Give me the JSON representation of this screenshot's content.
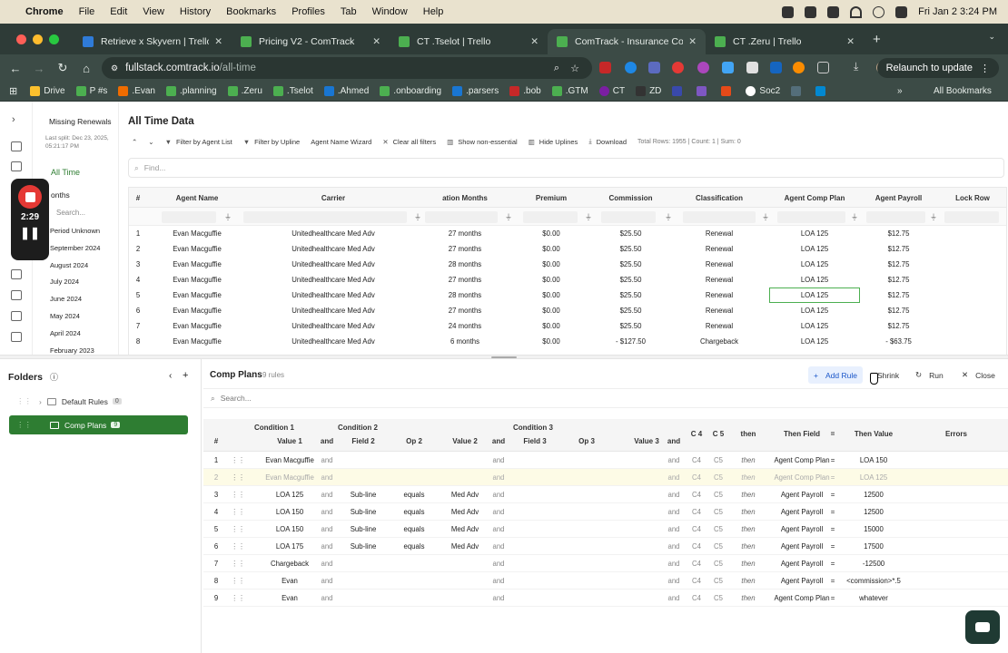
{
  "menubar": {
    "app": "Chrome",
    "items": [
      "File",
      "Edit",
      "View",
      "History",
      "Bookmarks",
      "Profiles",
      "Tab",
      "Window",
      "Help"
    ],
    "clock": "Fri Jan 2  3:24 PM"
  },
  "tabs": [
    {
      "title": "Retrieve x Skyvern | Trello",
      "active": false
    },
    {
      "title": "Pricing V2 - ComTrack",
      "active": false
    },
    {
      "title": "CT .Tselot | Trello",
      "active": false
    },
    {
      "title": "ComTrack - Insurance Comm",
      "active": true
    },
    {
      "title": "CT .Zeru | Trello",
      "active": false
    }
  ],
  "address": {
    "host": "fullstack.comtrack.io",
    "path": "/all-time",
    "relaunch": "Relaunch to update"
  },
  "bookmarks": [
    "Drive",
    "P #s",
    ".Evan",
    ".planning",
    ".Zeru",
    ".Tselot",
    ".Ahmed",
    ".onboarding",
    ".parsers",
    ".bob",
    ".GTM",
    "CT",
    "ZD",
    "",
    "",
    "Soc2",
    "",
    ""
  ],
  "bookmarks_all": "All Bookmarks",
  "recorder": {
    "time": "2:29"
  },
  "sidenav": {
    "title": "Missing Renewals",
    "subtitle": "Last split: Dec 23, 2025, 05:21:17 PM",
    "alltime": "All Time",
    "months_label": "onths",
    "search": "Search...",
    "months": [
      "Period Unknown",
      "September 2024",
      "August 2024",
      "July 2024",
      "June 2024",
      "May 2024",
      "April 2024",
      "February 2023"
    ]
  },
  "main": {
    "title": "All Time Data",
    "toolbar": [
      "Filter by Agent List",
      "Filter by Upline",
      "Agent Name Wizard",
      "Clear all filters",
      "Show non-essential",
      "Hide Uplines",
      "Download"
    ],
    "stats": "Total Rows: 1955 | Count: 1 | Sum: 0",
    "find_placeholder": "Find...",
    "columns": [
      "#",
      "Agent Name",
      "Carrier",
      "ation Months",
      "Premium",
      "Commission",
      "Classification",
      "Agent Comp Plan",
      "Agent Payroll",
      "Lock Row"
    ],
    "rows": [
      [
        "1",
        "Evan Macguffie",
        "Unitedhealthcare Med Adv",
        "27 months",
        "$0.00",
        "$25.50",
        "Renewal",
        "LOA 125",
        "$12.75"
      ],
      [
        "2",
        "Evan Macguffie",
        "Unitedhealthcare Med Adv",
        "27 months",
        "$0.00",
        "$25.50",
        "Renewal",
        "LOA 125",
        "$12.75"
      ],
      [
        "3",
        "Evan Macguffie",
        "Unitedhealthcare Med Adv",
        "28 months",
        "$0.00",
        "$25.50",
        "Renewal",
        "LOA 125",
        "$12.75"
      ],
      [
        "4",
        "Evan Macguffie",
        "Unitedhealthcare Med Adv",
        "27 months",
        "$0.00",
        "$25.50",
        "Renewal",
        "LOA 125",
        "$12.75"
      ],
      [
        "5",
        "Evan Macguffie",
        "Unitedhealthcare Med Adv",
        "28 months",
        "$0.00",
        "$25.50",
        "Renewal",
        "LOA 125",
        "$12.75"
      ],
      [
        "6",
        "Evan Macguffie",
        "Unitedhealthcare Med Adv",
        "27 months",
        "$0.00",
        "$25.50",
        "Renewal",
        "LOA 125",
        "$12.75"
      ],
      [
        "7",
        "Evan Macguffie",
        "Unitedhealthcare Med Adv",
        "24 months",
        "$0.00",
        "$25.50",
        "Renewal",
        "LOA 125",
        "$12.75"
      ],
      [
        "8",
        "Evan Macguffie",
        "Unitedhealthcare Med Adv",
        "6 months",
        "$0.00",
        "- $127.50",
        "Chargeback",
        "LOA 125",
        "- $63.75"
      ]
    ]
  },
  "folders": {
    "title": "Folders",
    "items": [
      {
        "label": "Default Rules",
        "count": "0"
      },
      {
        "label": "Comp Plans",
        "count": "9"
      }
    ]
  },
  "rules": {
    "title": "Comp Plans",
    "count": "9 rules",
    "add": "Add Rule",
    "shrink": "Shrink",
    "run": "Run",
    "close": "Close",
    "search": "Search...",
    "groups": [
      "Condition 1",
      "Condition 2",
      "Condition 3"
    ],
    "columns": [
      "#",
      "Value 1",
      "and",
      "Field 2",
      "Op 2",
      "Value 2",
      "and",
      "Field 3",
      "Op 3",
      "Value 3",
      "and",
      "C 4",
      "C 5",
      "then",
      "Then Field",
      "=",
      "Then Value",
      "Errors"
    ],
    "rows": [
      [
        "1",
        "Evan Macguffie",
        "and",
        "",
        "",
        "",
        "and",
        "",
        "",
        "",
        "and",
        "C4",
        "C5",
        "then",
        "Agent Comp Plan",
        "=",
        "LOA 150"
      ],
      [
        "2",
        "Evan Macguffie",
        "and",
        "",
        "",
        "",
        "and",
        "",
        "",
        "",
        "and",
        "C4",
        "C5",
        "then",
        "Agent Comp Plan",
        "=",
        "LOA 125"
      ],
      [
        "3",
        "LOA 125",
        "and",
        "Sub-line",
        "equals",
        "Med Adv",
        "and",
        "",
        "",
        "",
        "and",
        "C4",
        "C5",
        "then",
        "Agent Payroll",
        "=",
        "12500"
      ],
      [
        "4",
        "LOA 150",
        "and",
        "Sub-line",
        "equals",
        "Med Adv",
        "and",
        "",
        "",
        "",
        "and",
        "C4",
        "C5",
        "then",
        "Agent Payroll",
        "=",
        "12500"
      ],
      [
        "5",
        "LOA 150",
        "and",
        "Sub-line",
        "equals",
        "Med Adv",
        "and",
        "",
        "",
        "",
        "and",
        "C4",
        "C5",
        "then",
        "Agent Payroll",
        "=",
        "15000"
      ],
      [
        "6",
        "LOA 175",
        "and",
        "Sub-line",
        "equals",
        "Med Adv",
        "and",
        "",
        "",
        "",
        "and",
        "C4",
        "C5",
        "then",
        "Agent Payroll",
        "=",
        "17500"
      ],
      [
        "7",
        "Chargeback",
        "and",
        "",
        "",
        "",
        "and",
        "",
        "",
        "",
        "and",
        "C4",
        "C5",
        "then",
        "Agent Payroll",
        "=",
        "-12500"
      ],
      [
        "8",
        "Evan",
        "and",
        "",
        "",
        "",
        "and",
        "",
        "",
        "",
        "and",
        "C4",
        "C5",
        "then",
        "Agent Payroll",
        "=",
        "<commission>*.5"
      ],
      [
        "9",
        "Evan",
        "and",
        "",
        "",
        "",
        "and",
        "",
        "",
        "",
        "and",
        "C4",
        "C5",
        "then",
        "Agent Comp Plan",
        "=",
        "whatever"
      ]
    ]
  }
}
